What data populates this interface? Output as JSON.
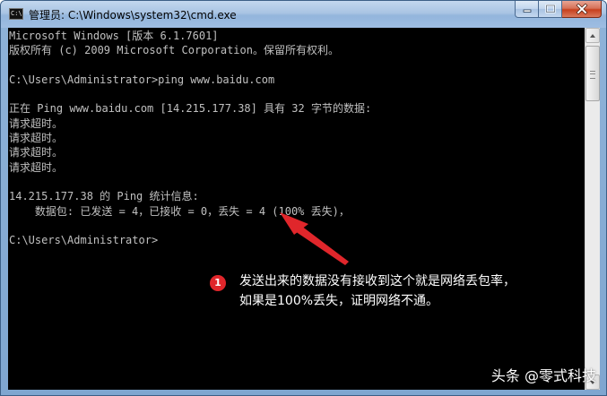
{
  "window": {
    "title": "管理员: C:\\Windows\\system32\\cmd.exe",
    "icon_label": "C:\\"
  },
  "title_buttons": {
    "minimize_icon": "minimize-icon",
    "maximize_icon": "maximize-icon",
    "close_icon": "close-icon"
  },
  "console": {
    "lines": [
      "Microsoft Windows [版本 6.1.7601]",
      "版权所有 (c) 2009 Microsoft Corporation。保留所有权利。",
      "",
      "C:\\Users\\Administrator>ping www.baidu.com",
      "",
      "正在 Ping www.baidu.com [14.215.177.38] 具有 32 字节的数据:",
      "请求超时。",
      "请求超时。",
      "请求超时。",
      "请求超时。",
      "",
      "14.215.177.38 的 Ping 统计信息:",
      "    数据包: 已发送 = 4，已接收 = 0，丢失 = 4 (100% 丢失)，",
      "",
      "C:\\Users\\Administrator>"
    ]
  },
  "annotation": {
    "number": "1",
    "lines": [
      "发送出来的数据没有接收到这个就是网络丢包率，",
      "如果是100%丢失，证明网络不通。"
    ]
  },
  "watermark": "头条 @零式科技",
  "colors": {
    "console_bg": "#000000",
    "console_text": "#c0c0c0",
    "annotation_red": "#e0262b",
    "close_button": "#c7401d"
  }
}
